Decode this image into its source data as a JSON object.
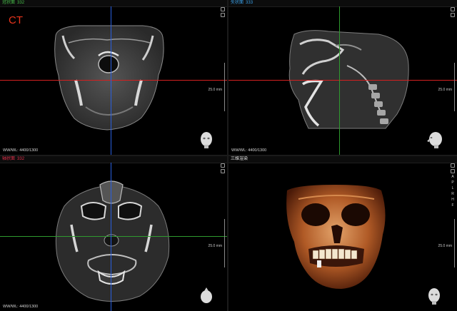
{
  "app": {
    "mode_label": "CT"
  },
  "panes": {
    "coronal": {
      "title": "冠状面",
      "slice": "332",
      "title_color": "#49c04b",
      "wwwl": "WW/WL: 4400/1300",
      "scale": "25.0 mm"
    },
    "sagittal": {
      "title": "矢状面",
      "slice": "333",
      "title_color": "#3aa0e8",
      "wwwl": "WW/WL: 4400/1300",
      "scale": "25.0 mm"
    },
    "axial": {
      "title": "轴状面",
      "slice": "332",
      "title_color": "#e0304b",
      "wwwl": "WW/WL: 4400/1300",
      "scale": "25.0 mm"
    },
    "volume": {
      "title": "三维渲染",
      "title_color": "#e8e8e8",
      "scale": "25.0 mm",
      "orientation_letters": [
        "A",
        "P",
        "L",
        "R",
        "H",
        "F"
      ]
    }
  },
  "crosshair_colors": {
    "red": "#d42020",
    "blue": "#2a5fe0",
    "green": "#2f9a2f"
  },
  "icons": [
    "camera-icon",
    "settings-icon",
    "head-orientation-icon"
  ]
}
